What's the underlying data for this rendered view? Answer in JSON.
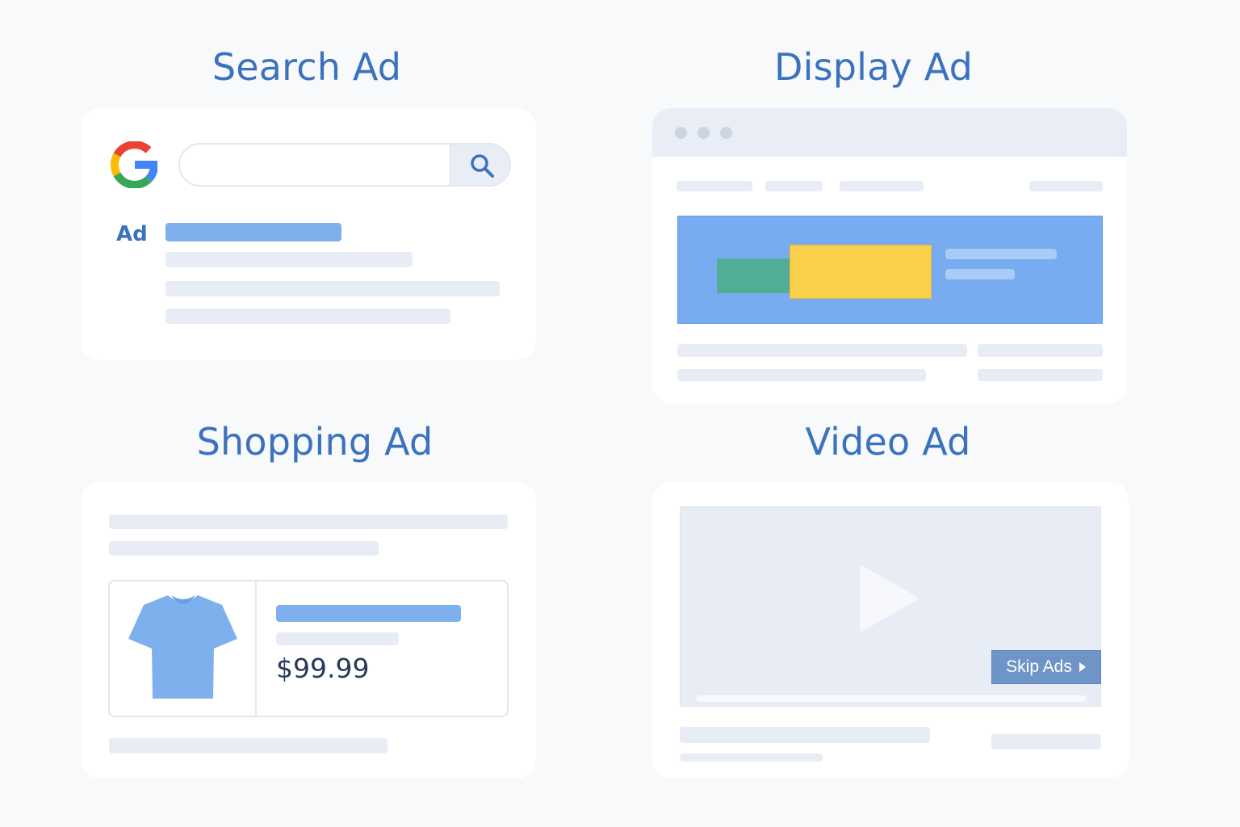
{
  "titles": {
    "search": "Search Ad",
    "display": "Display Ad",
    "shopping": "Shopping Ad",
    "video": "Video Ad"
  },
  "search_ad": {
    "ad_label": "Ad",
    "icons": [
      "google-logo-icon",
      "magnifier-icon"
    ]
  },
  "display_ad": {
    "colors": {
      "banner": "#78acf0",
      "green_block": "#52ad97",
      "yellow_block": "#fad04a"
    }
  },
  "shopping_ad": {
    "price": "$99.99",
    "icons": [
      "t-shirt-icon"
    ]
  },
  "video_ad": {
    "skip_label": "Skip Ads",
    "icons": [
      "play-icon",
      "caret-right-icon"
    ]
  },
  "colors": {
    "accent": "#3a72bd",
    "placeholder": "#e8edf5",
    "highlight": "#7fb0ee"
  }
}
